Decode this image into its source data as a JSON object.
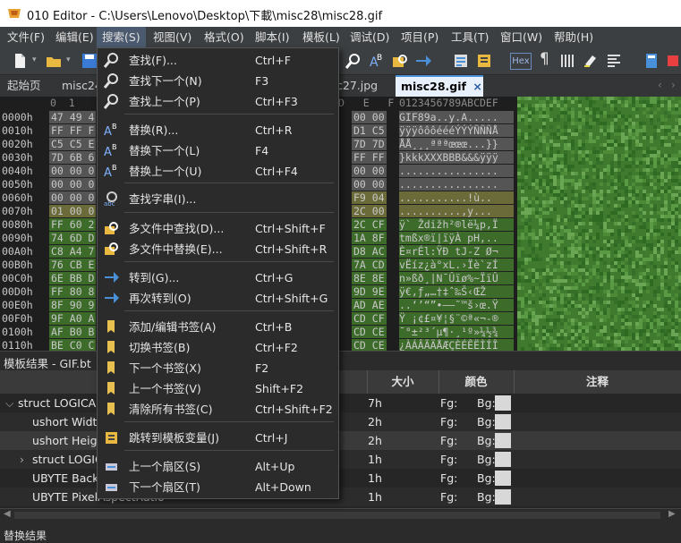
{
  "window": {
    "title": "010 Editor - C:\\Users\\Lenovo\\Desktop\\下載\\misc28\\misc28.gif"
  },
  "menubar": [
    {
      "label": "文件(F)"
    },
    {
      "label": "编辑(E)"
    },
    {
      "label": "搜索(S)"
    },
    {
      "label": "视图(V)"
    },
    {
      "label": "格式(O)"
    },
    {
      "label": "脚本(I)"
    },
    {
      "label": "模板(L)"
    },
    {
      "label": "调试(D)"
    },
    {
      "label": "项目(P)"
    },
    {
      "label": "工具(T)"
    },
    {
      "label": "窗口(W)"
    },
    {
      "label": "帮助(H)"
    }
  ],
  "toolbar": {
    "hex_label": "Hex"
  },
  "tabs": [
    {
      "label": "起始页"
    },
    {
      "label": "misc24"
    },
    {
      "label": "c27.jpg"
    },
    {
      "label": "misc28.gif",
      "close": "×"
    }
  ],
  "hex": {
    "col_header_right": "0 0 0 0",
    "col_header_lr": "D   E   F",
    "ascii_header": "0123456789ABCDEF",
    "rows": [
      {
        "addr": "0000h",
        "left": "47 49 4",
        "right": "00 00",
        "ascii": "GIF89a..y.A....."
      },
      {
        "addr": "0010h",
        "left": "FF FF F",
        "right": "D1 C5",
        "ascii": "ÿÿÿôôôéééÝÝÝÑÑÑÅ"
      },
      {
        "addr": "0020h",
        "left": "C5 C5 E",
        "right": "7D 7D",
        "ascii": "ÅÅ¸¸¸ªªªœœœ...}}"
      },
      {
        "addr": "0030h",
        "left": "7D 6B 6",
        "right": "FF FF",
        "ascii": "}kkkXXXBBB&&&ÿÿÿ"
      },
      {
        "addr": "0040h",
        "left": "00 00 0",
        "right": "00 00",
        "ascii": "................"
      },
      {
        "addr": "0050h",
        "left": "00 00 0",
        "right": "00 00",
        "ascii": "................"
      },
      {
        "addr": "0060h",
        "left": "00 00 0",
        "right": "F9 04",
        "ascii": "...........!ù.."
      },
      {
        "addr": "0070h",
        "left": "01 00 0",
        "right": "2C 00",
        "ascii": "..........,y..."
      },
      {
        "addr": "0080h",
        "left": "FF 60 2",
        "right": "2C CF",
        "ascii": "ÿ` Ždižh²®lë¼p,Ï"
      },
      {
        "addr": "0090h",
        "left": "74 6D D",
        "right": "1A 8F",
        "ascii": "tmßx®ï|ïÿÀ pH,.."
      },
      {
        "addr": "00A0h",
        "left": "C8 A4 7",
        "right": "D8 AC",
        "ascii": "È¤rÉl:ŸÐ tJ-Z Ø¬"
      },
      {
        "addr": "00B0h",
        "left": "76 CB E",
        "right": "7A CD",
        "ascii": "vËíz¿à°xL.›Ïè`zÍ"
      },
      {
        "addr": "00C0h",
        "left": "6E BB D",
        "right": "8E 8E",
        "ascii": "n»ßð¸|N¯Ûïø%~ÏïÛ"
      },
      {
        "addr": "00D0h",
        "left": "FF 80 8",
        "right": "9D 9E",
        "ascii": "ÿ€‚ƒ„…†‡ˆ‰Š‹ŒŽ"
      },
      {
        "addr": "00E0h",
        "left": "8F 90 9",
        "right": "AD AE",
        "ascii": "..‘’“”•–—˜™š›œ.Ÿ"
      },
      {
        "addr": "00F0h",
        "left": "9F A0 A",
        "right": "CD CF",
        "ascii": "Ÿ ¡¢£¤¥¦§¨©ª«¬-®"
      },
      {
        "addr": "0100h",
        "left": "AF B0 B",
        "right": "CD CE",
        "ascii": "¯°±²³´µ¶·¸¹º»¼½¾"
      },
      {
        "addr": "0110h",
        "left": "BE C0 C",
        "right": "CD CE",
        "ascii": "¿ÀÁÂÃÄÅÆÇÈÉÊËÌÍÎ"
      }
    ]
  },
  "template": {
    "title": "模板结果 - GIF.bt",
    "columns": [
      {
        "label": "名"
      },
      {
        "label": "值"
      },
      {
        "label": "大小"
      },
      {
        "label": "颜色"
      },
      {
        "label": "注释"
      }
    ],
    "rows": [
      {
        "name": "struct LOGICALS",
        "size": "7h",
        "fg": "Fg:",
        "bg": "Bg:",
        "expander": "⌵"
      },
      {
        "name": "ushort Width",
        "size": "2h",
        "fg": "Fg:",
        "bg": "Bg:"
      },
      {
        "name": "ushort Heigh",
        "size": "2h",
        "fg": "Fg:",
        "bg": "Bg:"
      },
      {
        "name": "struct LOGIC",
        "size": "1h",
        "fg": "Fg:",
        "bg": "Bg:",
        "expander": "›"
      },
      {
        "name": "UBYTE Backg",
        "size": "1h",
        "fg": "Fg:",
        "bg": "Bg:"
      },
      {
        "name": "UBYTE PixelAspectRatio",
        "size": "1h",
        "fg": "Fg:",
        "bg": "Bg:"
      }
    ]
  },
  "status": {
    "left": "替换结果"
  },
  "dropdown": {
    "items": [
      {
        "label": "查找(F)...",
        "shortcut": "Ctrl+F",
        "icon": "magnifier-icon"
      },
      {
        "label": "查找下一个(N)",
        "shortcut": "F3",
        "icon": "find-next-icon"
      },
      {
        "label": "查找上一个(P)",
        "shortcut": "Ctrl+F3",
        "icon": "find-prev-icon"
      },
      {
        "label": "替换(R)...",
        "shortcut": "Ctrl+R",
        "icon": "replace-icon"
      },
      {
        "label": "替换下一个(L)",
        "shortcut": "F4",
        "icon": "replace-next-icon"
      },
      {
        "label": "替换上一个(U)",
        "shortcut": "Ctrl+F4",
        "icon": "replace-prev-icon"
      },
      {
        "label": "查找字串(I)...",
        "shortcut": "",
        "icon": "find-strings-icon"
      },
      {
        "label": "多文件中查找(D)...",
        "shortcut": "Ctrl+Shift+F",
        "icon": "find-in-files-icon"
      },
      {
        "label": "多文件中替换(E)...",
        "shortcut": "Ctrl+Shift+R",
        "icon": "replace-in-files-icon"
      },
      {
        "label": "转到(G)...",
        "shortcut": "Ctrl+G",
        "icon": "goto-icon"
      },
      {
        "label": "再次转到(O)",
        "shortcut": "Ctrl+Shift+G",
        "icon": "goto-again-icon"
      },
      {
        "label": "添加/编辑书签(A)",
        "shortcut": "Ctrl+B",
        "icon": "bookmark-icon"
      },
      {
        "label": "切换书签(B)",
        "shortcut": "Ctrl+F2",
        "icon": "toggle-bookmark-icon"
      },
      {
        "label": "下一个书签(X)",
        "shortcut": "F2",
        "icon": "next-bookmark-icon"
      },
      {
        "label": "上一个书签(V)",
        "shortcut": "Shift+F2",
        "icon": "prev-bookmark-icon"
      },
      {
        "label": "清除所有书签(C)",
        "shortcut": "Ctrl+Shift+F2",
        "icon": "clear-bookmarks-icon"
      },
      {
        "label": "跳转到模板变量(J)",
        "shortcut": "Ctrl+J",
        "icon": "jump-template-var-icon"
      },
      {
        "label": "上一个扇区(S)",
        "shortcut": "Alt+Up",
        "icon": "prev-sector-icon"
      },
      {
        "label": "下一个扇区(T)",
        "shortcut": "Alt+Down",
        "icon": "next-sector-icon"
      }
    ]
  },
  "colors": {
    "accent": "#4a90d9",
    "hex_green": "#3d6b2a",
    "hex_blue": "#3a5a8a",
    "hex_olive": "#6b6b3a",
    "hex_purple": "#6a4a8a",
    "menu_active": "#4b5a6e"
  }
}
